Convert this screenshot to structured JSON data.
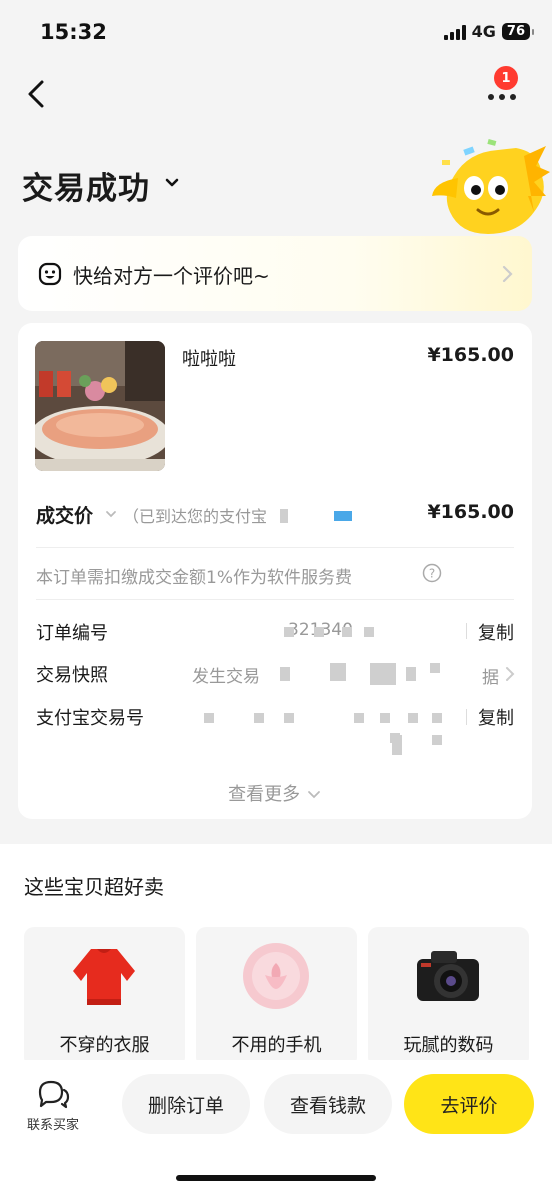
{
  "status_bar": {
    "time": "15:32",
    "network": "4G",
    "battery": "76"
  },
  "header": {
    "notification_count": "1",
    "title": "交易成功"
  },
  "rate_prompt": {
    "text": "快给对方一个评价吧~"
  },
  "order": {
    "product_name": "啦啦啦",
    "product_price": "¥165.00",
    "deal_label": "成交价",
    "deal_note": "（已到达您的支付宝",
    "deal_price": "¥165.00",
    "fee_note": "本订单需扣缴成交金额1%作为软件服务费",
    "rows": [
      {
        "label": "订单编号",
        "value": "         321340",
        "action": "复制"
      },
      {
        "label": "交易快照",
        "value": "发生交易   ",
        "action": ""
      },
      {
        "label": "支付宝交易号",
        "value": "",
        "action": "复制"
      }
    ],
    "snapshot_tail": "据",
    "see_more": "查看更多"
  },
  "recommend": {
    "title": "这些宝贝超好卖",
    "items": [
      {
        "label": "不穿的衣服",
        "icon": "sweater-icon"
      },
      {
        "label": "不用的手机",
        "icon": "phone-icon"
      },
      {
        "label": "玩腻的数码",
        "icon": "camera-icon"
      }
    ]
  },
  "bottom_bar": {
    "contact_label": "联系买家",
    "delete_label": "删除订单",
    "view_payment_label": "查看钱款",
    "review_label": "去评价"
  },
  "colors": {
    "accent": "#ffe417",
    "badge": "#ff3b30",
    "muted": "#999999"
  }
}
